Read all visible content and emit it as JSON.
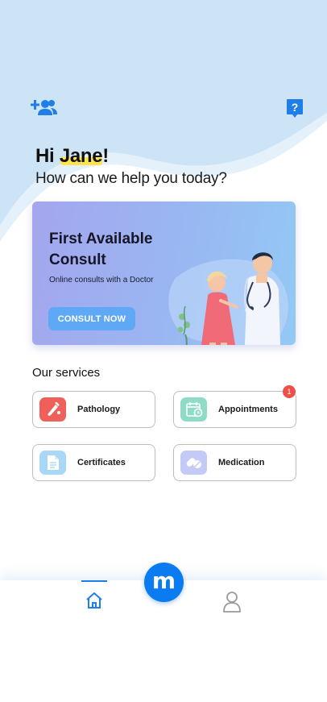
{
  "header": {
    "greeting_hi": "Hi ",
    "greeting_name": "Jane",
    "greeting_punct": "!",
    "subtitle": "How can we help you today?",
    "add_user_icon": "add-user-icon",
    "help_icon": "help-icon"
  },
  "consult_card": {
    "title": "First Available Consult",
    "subtitle": "Online consults with a Doctor",
    "button_label": "CONSULT NOW"
  },
  "services": {
    "title": "Our services",
    "items": [
      {
        "label": "Pathology",
        "icon": "test-tube-icon",
        "color": "#f0605a"
      },
      {
        "label": "Appointments",
        "icon": "calendar-clock-icon",
        "color": "#8fdcc6",
        "badge": "1"
      },
      {
        "label": "Certificates",
        "icon": "document-icon",
        "color": "#a9d8f7"
      },
      {
        "label": "Medication",
        "icon": "pills-icon",
        "color": "#c3caf6"
      }
    ]
  },
  "nav": {
    "home_icon": "home-icon",
    "profile_icon": "user-icon",
    "fab_label": "m"
  },
  "colors": {
    "accent": "#1f7ee8",
    "fab": "#0a7bf0",
    "background_wave": "#cce4f6"
  }
}
